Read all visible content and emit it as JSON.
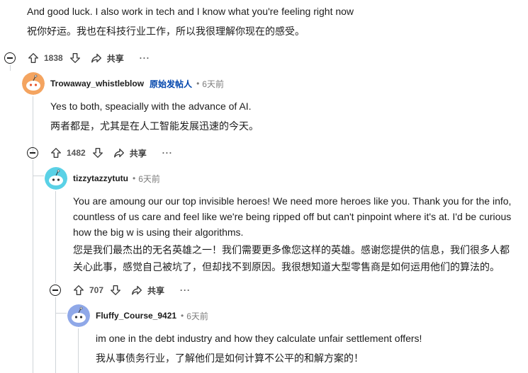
{
  "comments": {
    "c0": {
      "text_en": "And good luck. I also work in tech and I know what you're feeling right now",
      "text_zh": "祝你好运。我也在科技行业工作，所以我很理解你现在的感受。",
      "votes": "1838",
      "share_label": "共享",
      "more_label": "···"
    },
    "c1": {
      "username": "Trowaway_whistleblow",
      "op_badge": "原始发帖人",
      "age": "6天前",
      "text_en": "Yes to both, speacially with the advance of AI.",
      "text_zh": "两者都是，尤其是在人工智能发展迅速的今天。",
      "votes": "1482",
      "share_label": "共享",
      "more_label": "···",
      "avatar_color": "#f4a460"
    },
    "c2": {
      "username": "tizzytazzytutu",
      "age": "6天前",
      "text_en": "You are amoung our our top invisible heroes! We need more heroes like you. Thank you for the info, countless of us care and feel like we're being ripped off but can't pinpoint where it's at. I'd be curious how the big w is using their algorithms.",
      "text_zh": "您是我们最杰出的无名英雄之一！我们需要更多像您这样的英雄。感谢您提供的信息，我们很多人都关心此事，感觉自己被坑了，但却找不到原因。我很想知道大型零售商是如何运用他们的算法的。",
      "votes": "707",
      "share_label": "共享",
      "more_label": "···",
      "avatar_color": "#5ad1e6"
    },
    "c3": {
      "username": "Fluffy_Course_9421",
      "age": "6天前",
      "text_en": "im one in the debt industry and how they calculate unfair settlement offers!",
      "text_zh": "我从事债务行业，了解他们是如何计算不公平的和解方案的！",
      "avatar_color": "#8fa8e8"
    }
  }
}
